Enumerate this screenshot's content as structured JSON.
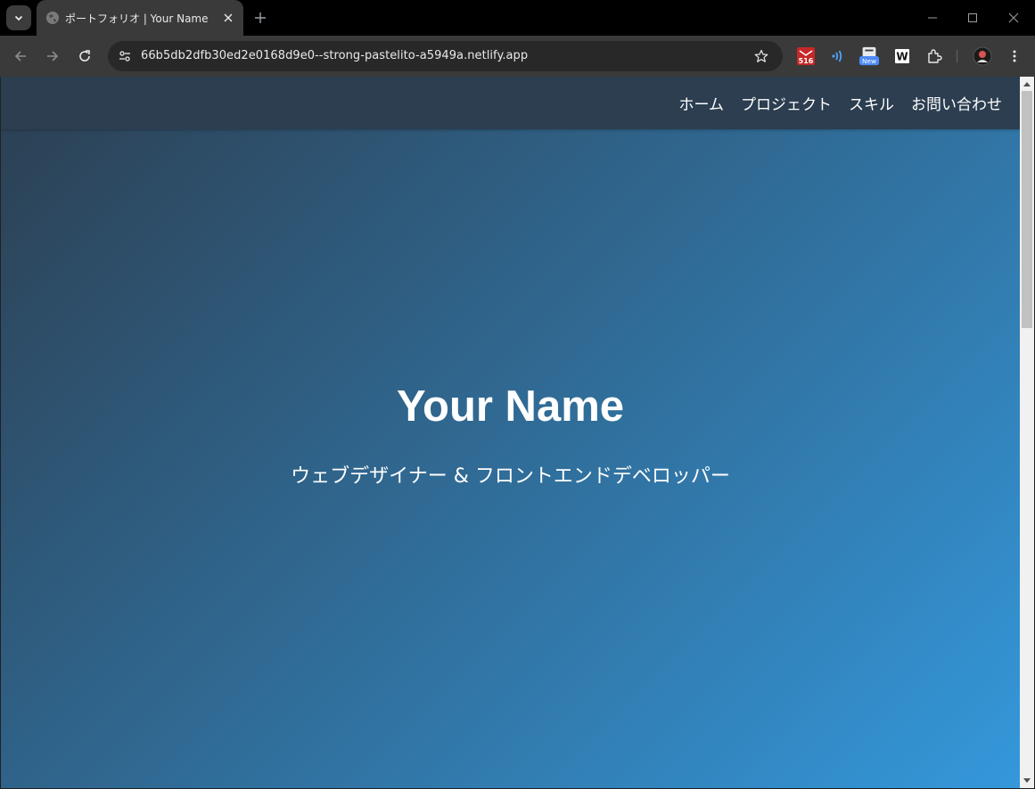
{
  "browser": {
    "tab": {
      "title": "ポートフォリオ | Your Name",
      "favicon": "globe-icon"
    },
    "url": "66b5db2dfb30ed2e0168d9e0--strong-pastelito-a5949a.netlify.app",
    "extensions": [
      {
        "name": "gmail-extension-icon",
        "badge": "516"
      },
      {
        "name": "audio-wave-extension-icon"
      },
      {
        "name": "new-extension-icon",
        "badge": "New"
      },
      {
        "name": "w-extension-icon",
        "label": "W"
      },
      {
        "name": "puzzle-extensions-icon"
      },
      {
        "name": "profile-avatar"
      },
      {
        "name": "more-menu-icon"
      }
    ]
  },
  "site": {
    "nav": [
      "ホーム",
      "プロジェクト",
      "スキル",
      "お問い合わせ"
    ],
    "hero": {
      "title": "Your Name",
      "subtitle": "ウェブデザイナー & フロントエンドデベロッパー"
    }
  },
  "colors": {
    "header": "#2c3e50",
    "gradient_start": "#2c3e50",
    "gradient_end": "#3498db"
  }
}
